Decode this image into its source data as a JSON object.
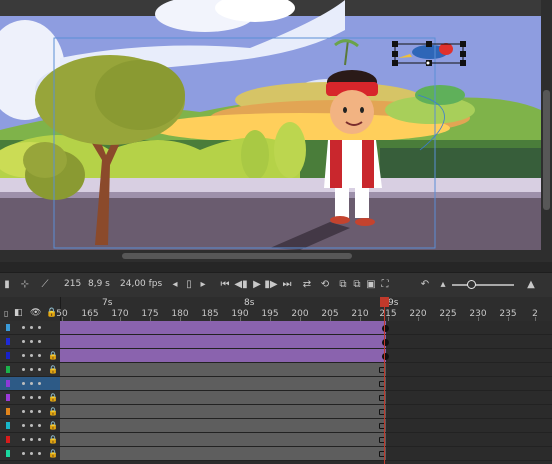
{
  "timeline": {
    "toolbar": {
      "frame_number": "215",
      "time": "8,9 s",
      "fps": "24,00 fps"
    },
    "ruler": {
      "major_labels": [
        "7s",
        "8s",
        "9s"
      ],
      "frame_labels": [
        "50",
        "165",
        "170",
        "175",
        "180",
        "185",
        "190",
        "195",
        "200",
        "205",
        "210",
        "215",
        "220",
        "225",
        "230",
        "235",
        "2"
      ]
    },
    "layers": [
      {
        "color": "#3a9bd9",
        "frames": "purple"
      },
      {
        "color": "#1e2ad8",
        "frames": "purple"
      },
      {
        "color": "#1822c9",
        "frames": "purple"
      },
      {
        "color": "#1bb24b",
        "frames": "gray"
      },
      {
        "color": "#8e3ad8",
        "frames": "gray",
        "selected": true
      },
      {
        "color": "#9b3ad8",
        "frames": "gray"
      },
      {
        "color": "#e2851b",
        "frames": "gray"
      },
      {
        "color": "#18b6c9",
        "frames": "gray"
      },
      {
        "color": "#d81b1b",
        "frames": "gray"
      },
      {
        "color": "#1bd8a0",
        "frames": "gray"
      }
    ]
  },
  "colors": {
    "sky": "#8e9de0",
    "selection": "#2d5a86",
    "playhead": "#c0392b",
    "tween": "#8a63ae"
  }
}
